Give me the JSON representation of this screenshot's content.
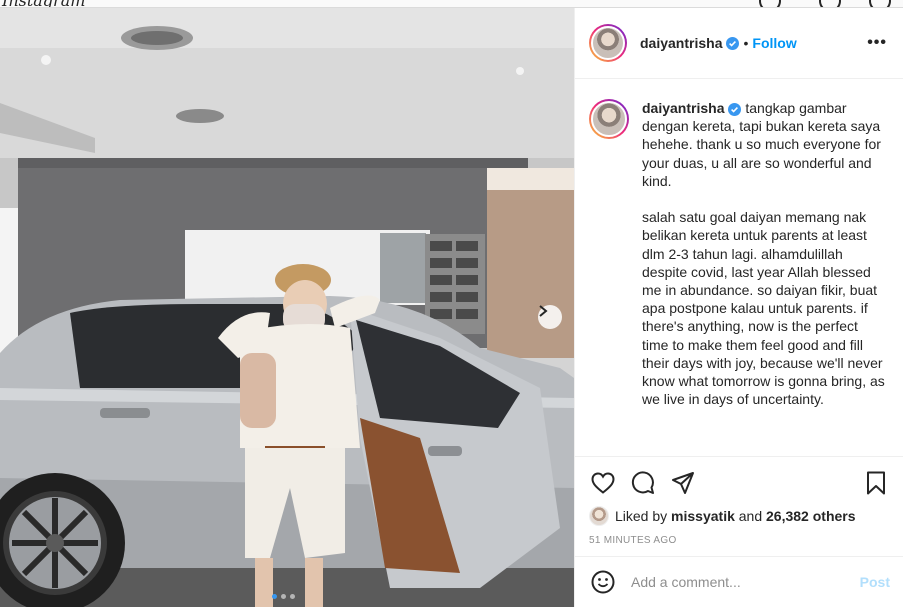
{
  "top_bar": {
    "logo_fragment": "Instagram"
  },
  "post": {
    "username": "daiyantrisha",
    "follow_label": "Follow",
    "separator": "•",
    "more_label": "•••",
    "caption": "tangkap gambar dengan kereta, tapi bukan kereta saya hehehe. thank u so much everyone for your duas, u all are so wonderful and kind.\n\nsalah satu goal daiyan memang nak belikan kereta untuk parents at least dlm 2-3 tahun lagi. alhamdulillah despite covid, last year Allah blessed me in abundance. so daiyan fikir, buat apa postpone kalau untuk parents. if there's anything, now is the perfect time to make them feel good and fill their days with joy, because we'll never know what tomorrow is gonna bring, as we live in days of uncertainty.",
    "liked_prefix": "Liked by",
    "liked_user": "missyatik",
    "liked_and": "and",
    "liked_others": "26,382 others",
    "timestamp": "51 MINUTES AGO",
    "carousel": {
      "total_slides": 3,
      "active_slide": 1
    }
  },
  "comment": {
    "placeholder": "Add a comment...",
    "post_label": "Post"
  },
  "icons": {
    "verified": "verified-badge-icon",
    "like": "heart-icon",
    "comment": "comment-bubble-icon",
    "share": "paper-plane-icon",
    "save": "bookmark-icon",
    "emoji": "smiley-icon",
    "next": "chevron-right-icon"
  },
  "colors": {
    "accent": "#0095f6",
    "verified": "#3897f0",
    "post_disabled": "#b2dffc",
    "muted": "#8e8e8e",
    "text": "#262626",
    "border": "#efefef"
  }
}
